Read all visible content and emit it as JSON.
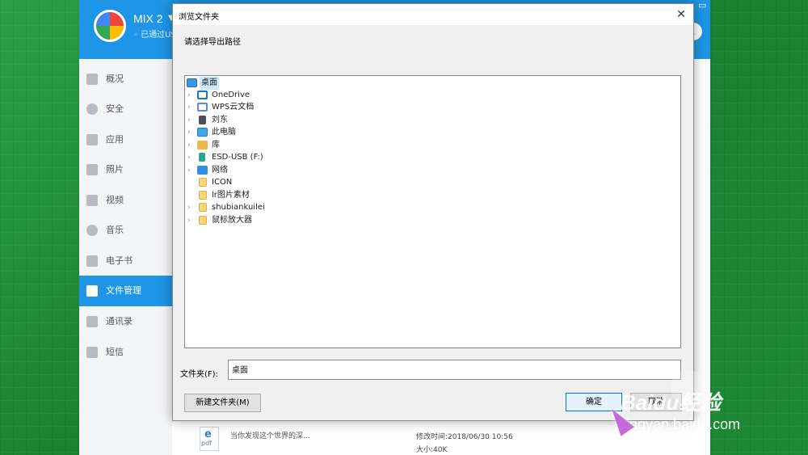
{
  "app": {
    "device_name": "MIX 2",
    "status_text": "已通过USB",
    "sidebar": [
      {
        "label": "概况",
        "icon": "home-icon"
      },
      {
        "label": "安全",
        "icon": "shield-icon"
      },
      {
        "label": "应用",
        "icon": "apps-icon"
      },
      {
        "label": "照片",
        "icon": "photo-icon"
      },
      {
        "label": "视频",
        "icon": "video-icon"
      },
      {
        "label": "音乐",
        "icon": "music-icon"
      },
      {
        "label": "电子书",
        "icon": "ebook-icon"
      },
      {
        "label": "文件管理",
        "icon": "folder-icon",
        "active": true
      },
      {
        "label": "通讯录",
        "icon": "contacts-icon"
      },
      {
        "label": "短信",
        "icon": "sms-icon"
      }
    ],
    "file": {
      "name": "当你发现这个世界的深...",
      "modified": "修改时间:2018/06/30 10:56",
      "size": "大小:40K",
      "icon_text": "pdf"
    }
  },
  "dialog": {
    "title": "浏览文件夹",
    "close_label": "✕",
    "prompt": "请选择导出路径",
    "tree": [
      {
        "label": "桌面",
        "icon": "desktop-icon",
        "expandable": false,
        "selected": true
      },
      {
        "label": "OneDrive",
        "icon": "onedrive-icon",
        "expandable": true
      },
      {
        "label": "WPS云文档",
        "icon": "wps-cloud-icon",
        "expandable": true
      },
      {
        "label": "刘东",
        "icon": "user-icon",
        "expandable": true
      },
      {
        "label": "此电脑",
        "icon": "computer-icon",
        "expandable": true
      },
      {
        "label": "库",
        "icon": "library-icon",
        "expandable": true
      },
      {
        "label": "ESD-USB (F:)",
        "icon": "usb-drive-icon",
        "expandable": true
      },
      {
        "label": "网络",
        "icon": "network-icon",
        "expandable": true
      },
      {
        "label": "ICON",
        "icon": "folder-icon",
        "expandable": false
      },
      {
        "label": "lr图片素材",
        "icon": "folder-icon",
        "expandable": false
      },
      {
        "label": "shubiankuilei",
        "icon": "folder-icon",
        "expandable": true
      },
      {
        "label": "鼠标放大器",
        "icon": "folder-icon",
        "expandable": true
      }
    ],
    "folder_label": "文件夹(F):",
    "folder_value": "桌面",
    "new_folder_button": "新建文件夹(M)",
    "ok_button": "确定",
    "cancel_button": "取消"
  },
  "watermark": {
    "logo": "Baidu经验",
    "sub": "jingyan.baidu.com"
  }
}
